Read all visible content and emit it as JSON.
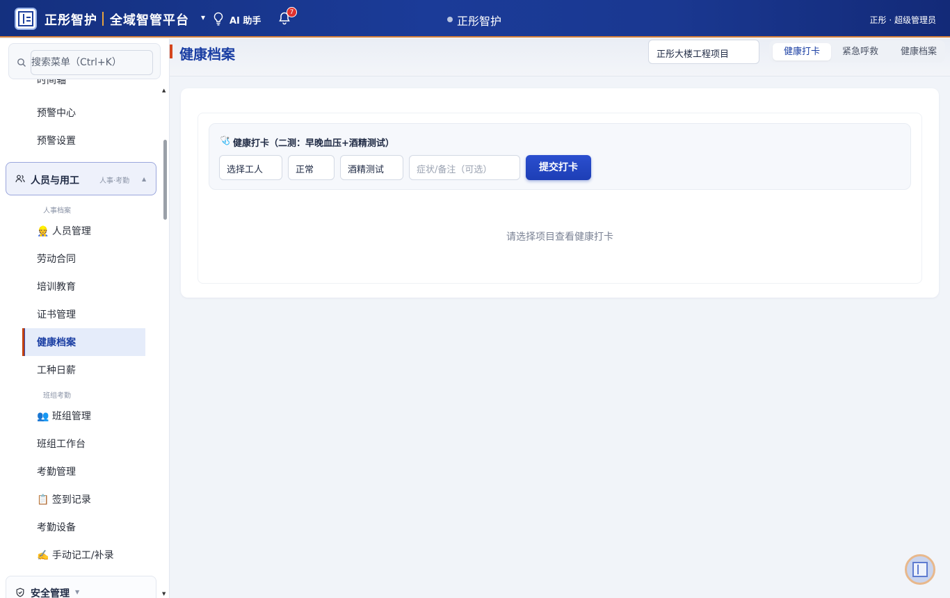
{
  "header": {
    "brand": "正彤智护",
    "platform": "全域智管平台",
    "dropdown_caret": "▾",
    "ai_label": "AI 助手",
    "notification_count": "7",
    "center_title": "正彤智护",
    "user": "正彤 · 超级管理员"
  },
  "sidebar": {
    "search_placeholder": "搜索菜单（Ctrl+K）",
    "cut_item": "时间轴",
    "items_top": [
      "预警中心",
      "预警设置"
    ],
    "group": {
      "label": "人员与用工",
      "sub": "人事·考勤",
      "caret": "▲"
    },
    "section1": "人事档案",
    "section1_items": [
      "👷 人员管理",
      "劳动合同",
      "培训教育",
      "证书管理"
    ],
    "active_item": "健康档案",
    "section1_after": [
      "工种日薪"
    ],
    "section2": "班组考勤",
    "section2_items": [
      "👥 班组管理",
      "班组工作台",
      "考勤管理",
      "📋 签到记录",
      "考勤设备",
      "✍️ 手动记工/补录"
    ],
    "group2": {
      "label": "安全管理",
      "caret": "▼"
    }
  },
  "main": {
    "title": "健康档案",
    "project": "正彤大楼工程项目",
    "tabs": [
      "健康打卡",
      "紧急呼救",
      "健康档案"
    ],
    "active_tab": 0,
    "form": {
      "icon": "🩺",
      "title": "健康打卡（二测：早晚血压+酒精测试）",
      "worker_select": "选择工人",
      "status_select": "正常",
      "test_select": "酒精测试",
      "note_placeholder": "症状/备注（可选）",
      "submit": "提交打卡"
    },
    "empty_hint": "请选择项目查看健康打卡"
  }
}
